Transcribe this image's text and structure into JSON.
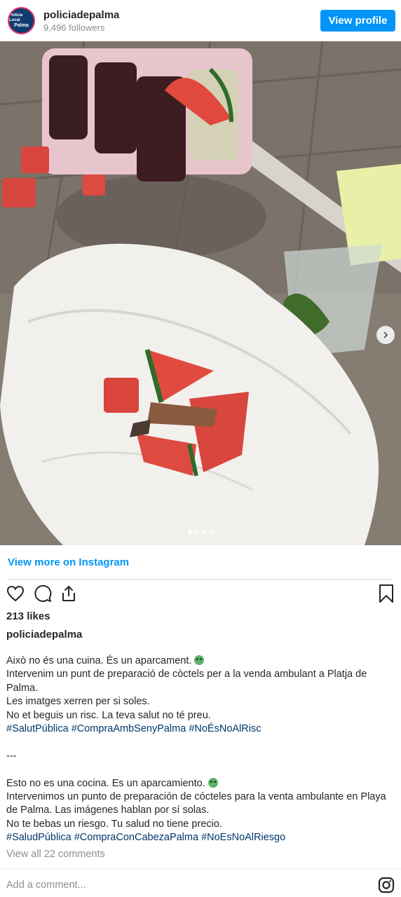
{
  "header": {
    "avatar_text_top": "Policia Local",
    "avatar_text_bottom": "Palma",
    "username": "policiadepalma",
    "followers": "9,496 followers",
    "view_profile_label": "View profile"
  },
  "photo": {
    "description_icon": "next-arrow-icon",
    "carousel_dot_count": 4,
    "carousel_active_index": 0
  },
  "links": {
    "view_more": "View more on Instagram"
  },
  "actions": {
    "icons": [
      "heart-icon",
      "comment-icon",
      "share-icon",
      "bookmark-icon"
    ]
  },
  "post": {
    "likes": "213 likes",
    "caption_username": "policiadepalma",
    "caption_lines": [
      "Això no és una cuina. És un aparcament.",
      "Intervenim un punt de preparació de còctels per a la venda ambulant a Platja de Palma.",
      "Les imatges xerren per si soles.",
      "No et beguis un risc. La teva salut no té preu.",
      "#SalutPública #CompraAmbSenyPalma #NoÉsNoAlRisc",
      "---",
      "Esto no es una cocina. Es un aparcamiento.",
      "Intervenimos un punto de preparación de cócteles para la venta ambulante en Playa de Palma. Las imágenes hablan por sí solas.",
      "No te bebas un riesgo. Tu salud no tiene precio.",
      "#SaludPública #CompraConCabezaPalma #NoEsNoAlRiesgo"
    ],
    "view_comments": "View all 22 comments",
    "add_comment_placeholder": "Add a comment..."
  },
  "colors": {
    "accent": "#0095f6",
    "hashtag": "#00376b",
    "muted": "#8e8e8e"
  }
}
